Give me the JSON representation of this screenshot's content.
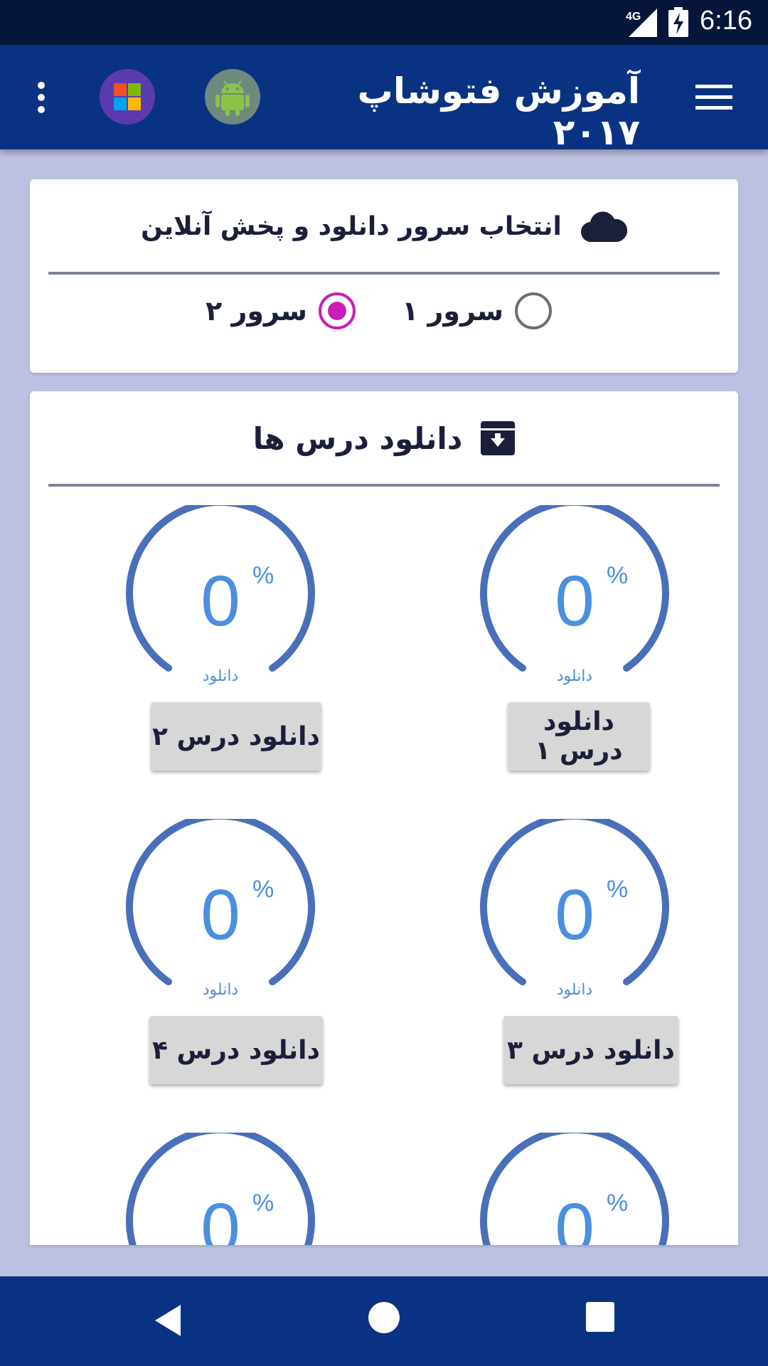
{
  "status_bar": {
    "network_label": "4G",
    "time": "6:16",
    "icons": [
      "signal-icon",
      "battery-charging-icon"
    ]
  },
  "app_bar": {
    "title": "آموزش فتوشاپ ۲۰۱۷",
    "icons": [
      "hamburger-menu-icon",
      "android-icon",
      "windows-icon",
      "more-vert-icon"
    ],
    "colors": {
      "background": "#0a3282",
      "android_bg": "#6d8a7c",
      "android_fg": "#8bc34a",
      "windows_bg": "#5b3ab0"
    }
  },
  "server_card": {
    "title": "انتخاب سرور دانلود و پخش آنلاین",
    "icon": "cloud-icon",
    "options": [
      {
        "label": "سرور ۱",
        "selected": false
      },
      {
        "label": "سرور ۲",
        "selected": true
      }
    ],
    "accent_color": "#c81eb4"
  },
  "lessons_card": {
    "title": "دانلود درس ها",
    "icon": "archive-download-icon",
    "lessons": [
      {
        "button_label": "دانلود درس ۱",
        "progress_value": "0",
        "progress_sign": "%",
        "gauge_label": "دانلود",
        "progress": 0
      },
      {
        "button_label": "دانلود درس ۲",
        "progress_value": "0",
        "progress_sign": "%",
        "gauge_label": "دانلود",
        "progress": 0
      },
      {
        "button_label": "دانلود درس ۳",
        "progress_value": "0",
        "progress_sign": "%",
        "gauge_label": "دانلود",
        "progress": 0
      },
      {
        "button_label": "دانلود درس ۴",
        "progress_value": "0",
        "progress_sign": "%",
        "gauge_label": "دانلود",
        "progress": 0
      },
      {
        "button_label": "",
        "progress_value": "0",
        "progress_sign": "%",
        "gauge_label": "",
        "progress": 0
      },
      {
        "button_label": "",
        "progress_value": "0",
        "progress_sign": "%",
        "gauge_label": "",
        "progress": 0
      }
    ],
    "gauge_color": "#4a6fba",
    "text_color": "#4a8fe0"
  },
  "nav_bar": {
    "icons": [
      "back-icon",
      "home-icon",
      "recents-icon"
    ]
  }
}
